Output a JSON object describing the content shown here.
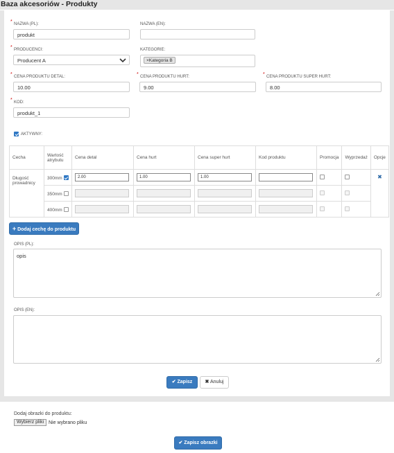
{
  "header": {
    "title": "Baza akcesoriów - Produkty"
  },
  "form": {
    "required_mark": "*",
    "name_pl": {
      "label": "NAZWA (PL):",
      "value": "produkt"
    },
    "name_en": {
      "label": "NAZWA (EN):",
      "value": ""
    },
    "producer": {
      "label": "PRODUCENCI:",
      "value": "Producent A"
    },
    "categories": {
      "label": "KATEGORIE:",
      "tag": "Kategoria B",
      "tag_remove": "×"
    },
    "price_retail": {
      "label": "CENA PRODUKTU DETAL:",
      "value": "10.00"
    },
    "price_wholesale": {
      "label": "CENA PRODUKTU HURT:",
      "value": "9.00"
    },
    "price_super_wholesale": {
      "label": "CENA PRODUKTU SUPER HURT:",
      "value": "8.00"
    },
    "code": {
      "label": "KOD:",
      "value": "produkt_1"
    },
    "active": {
      "label": "AKTYWNY:",
      "checked": true
    }
  },
  "cache_table": {
    "headers": [
      "Cecha",
      "Wartość atrybutu",
      "Cena detal",
      "Cena hurt",
      "Cena super hurt",
      "Kod produktu",
      "Promocja",
      "Wyprzedaż",
      "Opcje"
    ],
    "feature": "Długość prowadnicy",
    "rows": [
      {
        "value": "300mm",
        "checked": true,
        "retail": "2.00",
        "wholesale": "1.00",
        "super": "1.00",
        "code": "",
        "enabled": true
      },
      {
        "value": "350mm",
        "checked": false,
        "retail": "",
        "wholesale": "",
        "super": "",
        "code": "",
        "enabled": false
      },
      {
        "value": "400mm",
        "checked": false,
        "retail": "",
        "wholesale": "",
        "super": "",
        "code": "",
        "enabled": false
      }
    ],
    "remove_icon": "✖"
  },
  "buttons": {
    "add_cache": "Dodaj cechę do produktu",
    "save": "Zapisz",
    "cancel": "Anuluj",
    "save_images": "Zapisz obrazki"
  },
  "description": {
    "pl": {
      "label": "OPIS (PL):",
      "value": "opis"
    },
    "en": {
      "label": "OPIS (EN):",
      "value": ""
    }
  },
  "images": {
    "label": "Dodaj obrazki do produktu:",
    "choose_button": "Wybierz pliki",
    "no_file": "Nie wybrano pliku"
  },
  "colors": {
    "accent": "#3a7bbf",
    "required": "#cc0000"
  }
}
